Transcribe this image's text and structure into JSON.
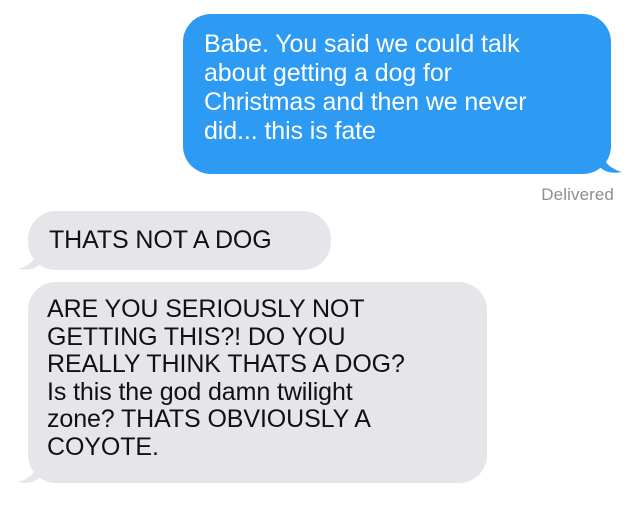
{
  "thread": {
    "messages": [
      {
        "direction": "sent",
        "text": "Babe. You said we could talk\nabout getting a dog for\nChristmas and then we never\ndid... this is fate"
      },
      {
        "direction": "received",
        "text": "THATS NOT A DOG"
      },
      {
        "direction": "received",
        "text": "ARE YOU SERIOUSLY NOT\nGETTING THIS?! DO YOU\nREALLY THINK THATS A DOG?\nIs this the god damn twilight\nzone? THATS OBVIOUSLY A\nCOYOTE."
      }
    ],
    "delivery_status": "Delivered"
  },
  "colors": {
    "sent_bubble": "#2d9bf4",
    "received_bubble": "#e6e5ea",
    "status_text": "#8e8e93"
  }
}
